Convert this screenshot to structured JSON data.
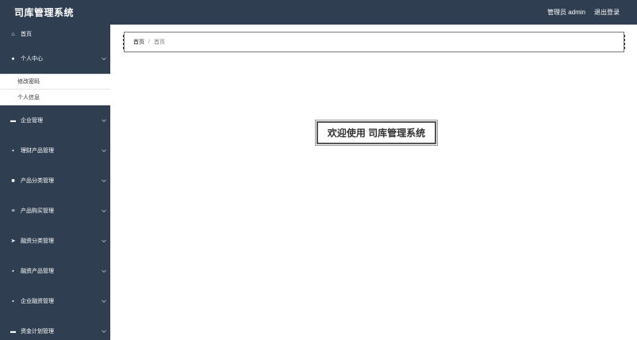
{
  "header": {
    "app_title": "司库管理系统",
    "admin_label": "管理员 admin",
    "logout_label": "退出登录"
  },
  "sidebar": {
    "home_label": "首页",
    "items": [
      {
        "label": "个人中心",
        "icon": "user-icon",
        "expanded": true,
        "children": [
          "修改密码",
          "个人信息"
        ]
      },
      {
        "label": "企业管理",
        "icon": "briefcase-icon"
      },
      {
        "label": "理财产品管理",
        "icon": "grid-icon"
      },
      {
        "label": "产品分类管理",
        "icon": "tag-icon"
      },
      {
        "label": "产品购买管理",
        "icon": "sliders-icon"
      },
      {
        "label": "融资分类管理",
        "icon": "rocket-icon"
      },
      {
        "label": "融资产品管理",
        "icon": "grid-icon"
      },
      {
        "label": "企业融资管理",
        "icon": "grid-icon"
      },
      {
        "label": "资金计划管理",
        "icon": "briefcase-icon"
      }
    ]
  },
  "breadcrumb": {
    "home": "首页",
    "separator": "/",
    "current": "首页"
  },
  "main": {
    "welcome_text": "欢迎使用 司库管理系统"
  },
  "colors": {
    "topbar_bg": "#2f3e50",
    "sidebar_bg": "#2f3e50"
  }
}
